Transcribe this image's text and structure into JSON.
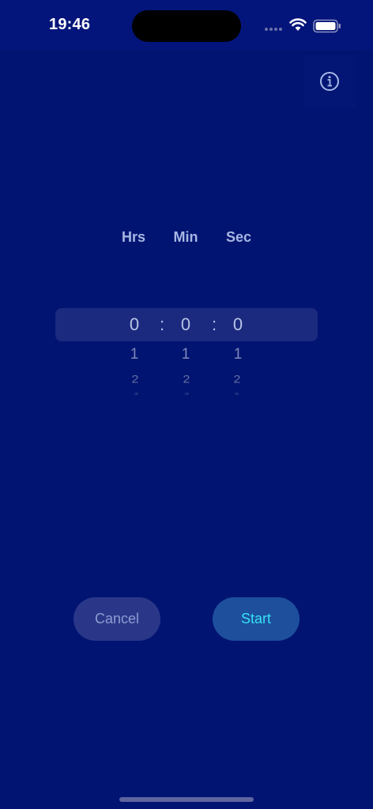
{
  "status_bar": {
    "time": "19:46"
  },
  "info_button": {
    "icon": "info-circle-icon"
  },
  "picker": {
    "labels": {
      "hours": "Hrs",
      "minutes": "Min",
      "seconds": "Sec"
    },
    "selected": {
      "hours": "0",
      "minutes": "0",
      "seconds": "0"
    },
    "separator": ":",
    "below_1": {
      "hours": "1",
      "minutes": "1",
      "seconds": "1"
    },
    "below_2": {
      "hours": "2",
      "minutes": "2",
      "seconds": "2"
    },
    "below_3": {
      "hours": "3",
      "minutes": "3",
      "seconds": "3"
    }
  },
  "actions": {
    "cancel_label": "Cancel",
    "start_label": "Start"
  },
  "colors": {
    "background": "#021472",
    "start_text": "#35e2f5",
    "label_text": "#a7b7e4"
  }
}
